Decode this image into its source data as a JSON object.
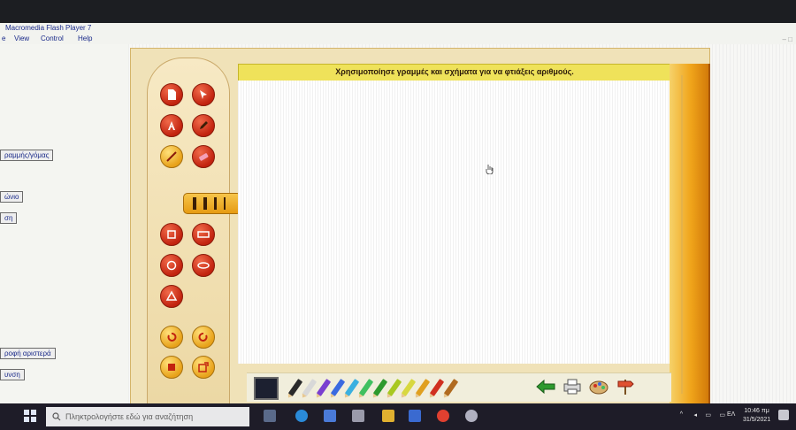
{
  "window": {
    "title": "Macromedia Flash Player 7",
    "menu": [
      "e",
      "View",
      "Control",
      "Help"
    ]
  },
  "sidebar": {
    "buttons": [
      {
        "label": "ραμμής/γόμας"
      },
      {
        "label": "ώνιο"
      },
      {
        "label": "ση"
      },
      {
        "label": "ροφή αριστερά"
      },
      {
        "label": "υνση"
      }
    ]
  },
  "app": {
    "instruction": "Χρησιμοποίησε γραμμές και σχήματα για να φτιάξεις αριθμούς.",
    "selected_color": "#1c2030",
    "pencil_colors": [
      "#2a2a2a",
      "#d8d8d8",
      "#7a3fd0",
      "#3a6ae0",
      "#3ab0e0",
      "#40c060",
      "#2e9a2e",
      "#a8c820",
      "#d8d840",
      "#e0a020",
      "#d03020",
      "#b06a20"
    ]
  },
  "taskbar": {
    "search_placeholder": "Πληκτρολογήστε εδώ για αναζήτηση",
    "lang": "ΕΛ",
    "time": "10:46 πμ",
    "date": "31/5/2021"
  }
}
